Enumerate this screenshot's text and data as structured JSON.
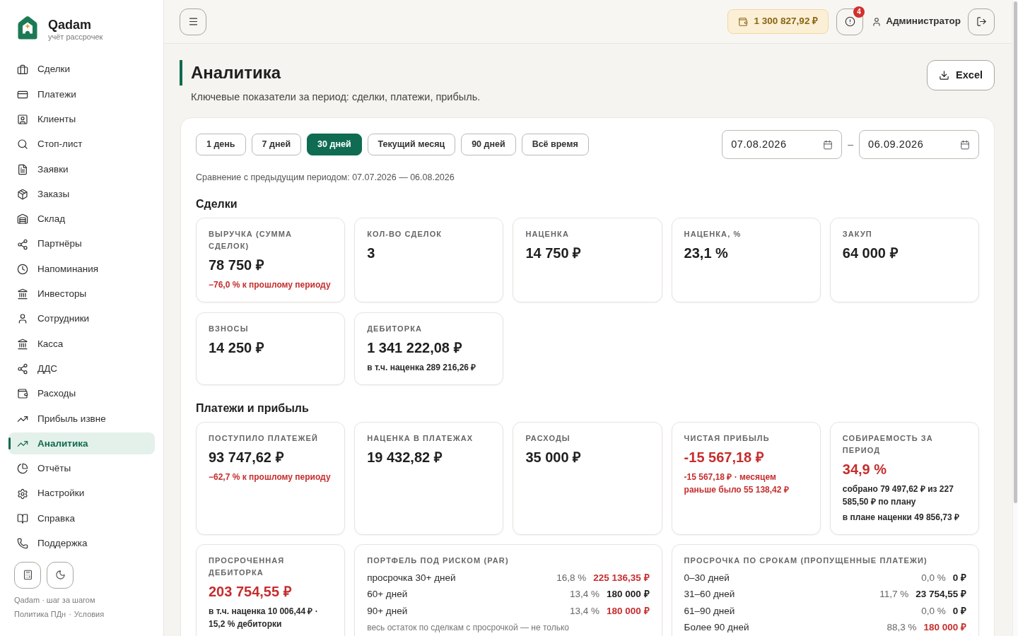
{
  "sidebar": {
    "brand": {
      "name": "Qadam",
      "tagline": "учёт рассрочек"
    },
    "nav": [
      {
        "label": "Сделки",
        "selected": false
      },
      {
        "label": "Платежи",
        "selected": false
      },
      {
        "label": "Клиенты",
        "selected": false
      },
      {
        "label": "Стоп-лист",
        "selected": false
      },
      {
        "label": "Заявки",
        "selected": false
      },
      {
        "label": "Заказы",
        "selected": false
      },
      {
        "label": "Склад",
        "selected": false
      },
      {
        "label": "Партнёры",
        "selected": false
      },
      {
        "label": "Напоминания",
        "selected": false
      },
      {
        "label": "Инвесторы",
        "selected": false
      },
      {
        "label": "Сотрудники",
        "selected": false
      },
      {
        "label": "Касса",
        "selected": false
      },
      {
        "label": "ДДС",
        "selected": false
      },
      {
        "label": "Расходы",
        "selected": false
      },
      {
        "label": "Прибыль извне",
        "selected": false
      },
      {
        "label": "Аналитика",
        "selected": true
      },
      {
        "label": "Отчёты",
        "selected": false
      },
      {
        "label": "Настройки",
        "selected": false
      },
      {
        "label": "Справка",
        "selected": false
      },
      {
        "label": "Поддержка",
        "selected": false
      }
    ],
    "footer": {
      "tagline": "Qadam · шаг за шагом",
      "links": [
        "Политика ПДн",
        "Условия"
      ],
      "link_separator": "·"
    }
  },
  "top_bar": {
    "balance": "1 300 827,92 ₽",
    "alert_count": "4",
    "user_name": "Администратор"
  },
  "header": {
    "title": "Аналитика",
    "subtitle": "Ключевые показатели за период: сделки, платежи, прибыль.",
    "export_button": "Excel"
  },
  "filters": {
    "periods": [
      {
        "label": "1 день",
        "selected": false
      },
      {
        "label": "7 дней",
        "selected": false
      },
      {
        "label": "30 дней",
        "selected": true
      },
      {
        "label": "Текущий месяц",
        "selected": false
      },
      {
        "label": "90 дней",
        "selected": false
      },
      {
        "label": "Всё время",
        "selected": false
      }
    ],
    "date_from": "07.08.2026",
    "date_separator": "–",
    "date_to": "06.09.2026",
    "comparison": "Сравнение с предыдущим периодом: 07.07.2026 — 06.08.2026"
  },
  "sections": [
    {
      "title": "Сделки",
      "cards": [
        {
          "kind": "stat",
          "label": "ВЫРУЧКА (СУММА СДЕЛОК)",
          "value": "78 750 ₽",
          "negative": false,
          "notes": [
            {
              "text": "−76,0 % к прошлому периоду",
              "negative": true
            }
          ]
        },
        {
          "kind": "stat",
          "label": "КОЛ-ВО СДЕЛОК",
          "value": "3",
          "negative": false
        },
        {
          "kind": "stat",
          "label": "НАЦЕНКА",
          "value": "14 750 ₽",
          "negative": false
        },
        {
          "kind": "stat",
          "label": "НАЦЕНКА, %",
          "value": "23,1 %",
          "negative": false
        },
        {
          "kind": "stat",
          "label": "ЗАКУП",
          "value": "64 000 ₽",
          "negative": false
        },
        {
          "kind": "stat",
          "label": "ВЗНОСЫ",
          "value": "14 250 ₽",
          "negative": false
        },
        {
          "kind": "stat",
          "label": "ДЕБИТОРКА",
          "value": "1 341 222,08 ₽",
          "negative": false,
          "notes": [
            {
              "text": "в т.ч. наценка 289 216,26 ₽",
              "negative": false
            }
          ]
        }
      ]
    },
    {
      "title": "Платежи и прибыль",
      "cards": [
        {
          "kind": "stat",
          "label": "ПОСТУПИЛО ПЛАТЕЖЕЙ",
          "value": "93 747,62 ₽",
          "negative": false,
          "notes": [
            {
              "text": "−62,7 % к прошлому периоду",
              "negative": true
            }
          ]
        },
        {
          "kind": "stat",
          "label": "НАЦЕНКА В ПЛАТЕЖАХ",
          "value": "19 432,82 ₽",
          "negative": false
        },
        {
          "kind": "stat",
          "label": "РАСХОДЫ",
          "value": "35 000 ₽",
          "negative": false
        },
        {
          "kind": "stat",
          "label": "ЧИСТАЯ ПРИБЫЛЬ",
          "value": "-15 567,18 ₽",
          "negative": true,
          "notes": [
            {
              "text": "-15 567,18 ₽ · месяцем раньше было 55 138,42 ₽",
              "negative": true
            }
          ]
        },
        {
          "kind": "stat",
          "label": "СОБИРАЕМОСТЬ ЗА ПЕРИОД",
          "value": "34,9 %",
          "negative": true,
          "notes": [
            {
              "text": "собрано 79 497,62 ₽ из 227 585,50 ₽ по плану",
              "negative": false
            },
            {
              "text": "в плане наценки 49 856,73 ₽",
              "negative": false
            }
          ]
        },
        {
          "kind": "stat",
          "label": "ПРОСРОЧЕННАЯ ДЕБИТОРКА",
          "value": "203 754,55 ₽",
          "negative": true,
          "notes": [
            {
              "text": "в т.ч. наценка 10 006,44 ₽ · 15,2 % дебиторки",
              "negative": false
            }
          ]
        },
        {
          "kind": "table",
          "label": "ПОРТФЕЛЬ ПОД РИСКОМ (PAR)",
          "rows": [
            {
              "label": "просрочка 30+ дней",
              "share": "16,8 %",
              "amount": "225 136,35 ₽",
              "negative": true
            },
            {
              "label": "60+ дней",
              "share": "13,4 %",
              "amount": "180 000 ₽",
              "negative": false
            },
            {
              "label": "90+ дней",
              "share": "13,4 %",
              "amount": "180 000 ₽",
              "negative": true
            }
          ],
          "footnote": "весь остаток по сделкам с просрочкой — не только"
        },
        {
          "kind": "table",
          "label": "ПРОСРОЧКА ПО СРОКАМ (ПРОПУЩЕННЫЕ ПЛАТЕЖИ)",
          "rows": [
            {
              "label": "0–30 дней",
              "share": "0,0 %",
              "amount": "0 ₽",
              "negative": false
            },
            {
              "label": "31–60 дней",
              "share": "11,7 %",
              "amount": "23 754,55 ₽",
              "negative": false
            },
            {
              "label": "61–90 дней",
              "share": "0,0 %",
              "amount": "0 ₽",
              "negative": false
            },
            {
              "label": "Более 90 дней",
              "share": "88,3 %",
              "amount": "180 000 ₽",
              "negative": true
            }
          ]
        }
      ]
    }
  ]
}
